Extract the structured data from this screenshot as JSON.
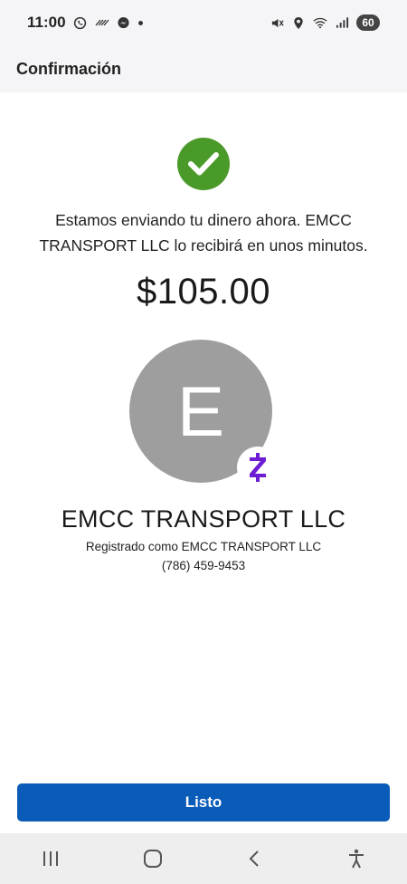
{
  "status_bar": {
    "time": "11:00",
    "battery": "60",
    "left_icons": [
      "whatsapp-icon",
      "missed-call-icon",
      "messenger-icon",
      "notification-dot"
    ],
    "right_icons": [
      "mute-icon",
      "location-icon",
      "wifi-icon",
      "signal-icon",
      "battery-icon"
    ]
  },
  "header": {
    "title": "Confirmación"
  },
  "confirmation": {
    "icon": "checkmark-icon",
    "message": "Estamos enviando tu dinero ahora. EMCC TRANSPORT LLC lo recibirá en unos minutos.",
    "amount": "$105.00"
  },
  "recipient": {
    "avatar_letter": "E",
    "badge_icon": "zelle-icon",
    "name": "EMCC TRANSPORT LLC",
    "registered_as": "Registrado como EMCC TRANSPORT LLC",
    "phone": "(786) 459-9453"
  },
  "actions": {
    "done_label": "Listo"
  },
  "nav": {
    "items": [
      "recent-apps-icon",
      "home-icon",
      "back-icon",
      "accessibility-icon"
    ]
  },
  "colors": {
    "success_green": "#4a9a2a",
    "primary_blue": "#0a5cb8",
    "avatar_gray": "#9e9e9e",
    "zelle_purple": "#6d1ed4"
  }
}
